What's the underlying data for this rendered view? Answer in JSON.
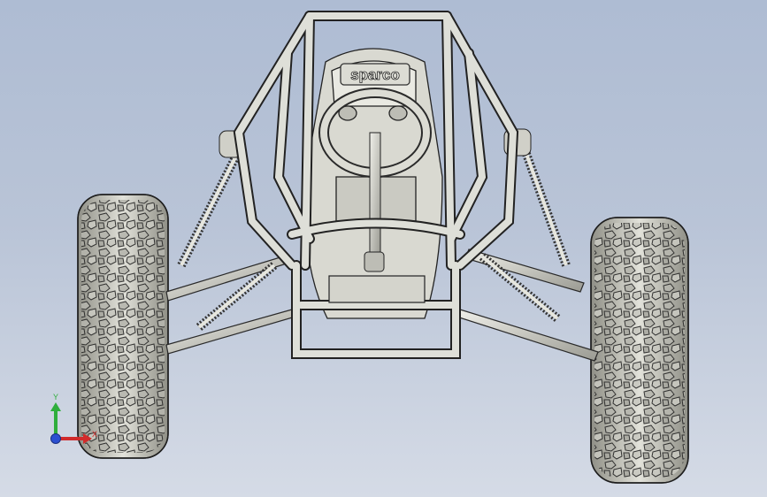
{
  "viewport": {
    "colors": {
      "background_top": "#aebcd3",
      "background_bottom": "#d5dbe6",
      "part_shade": "#c9c9c0",
      "part_highlight": "#ecece6",
      "part_edge": "#2a2a2a"
    }
  },
  "model": {
    "seat_logo_text": "sparco"
  },
  "triad": {
    "y_label": "Y",
    "x_label": "X",
    "y_color": "#2fae3c",
    "x_color": "#d12b2b",
    "z_color": "#2b4fd1"
  }
}
